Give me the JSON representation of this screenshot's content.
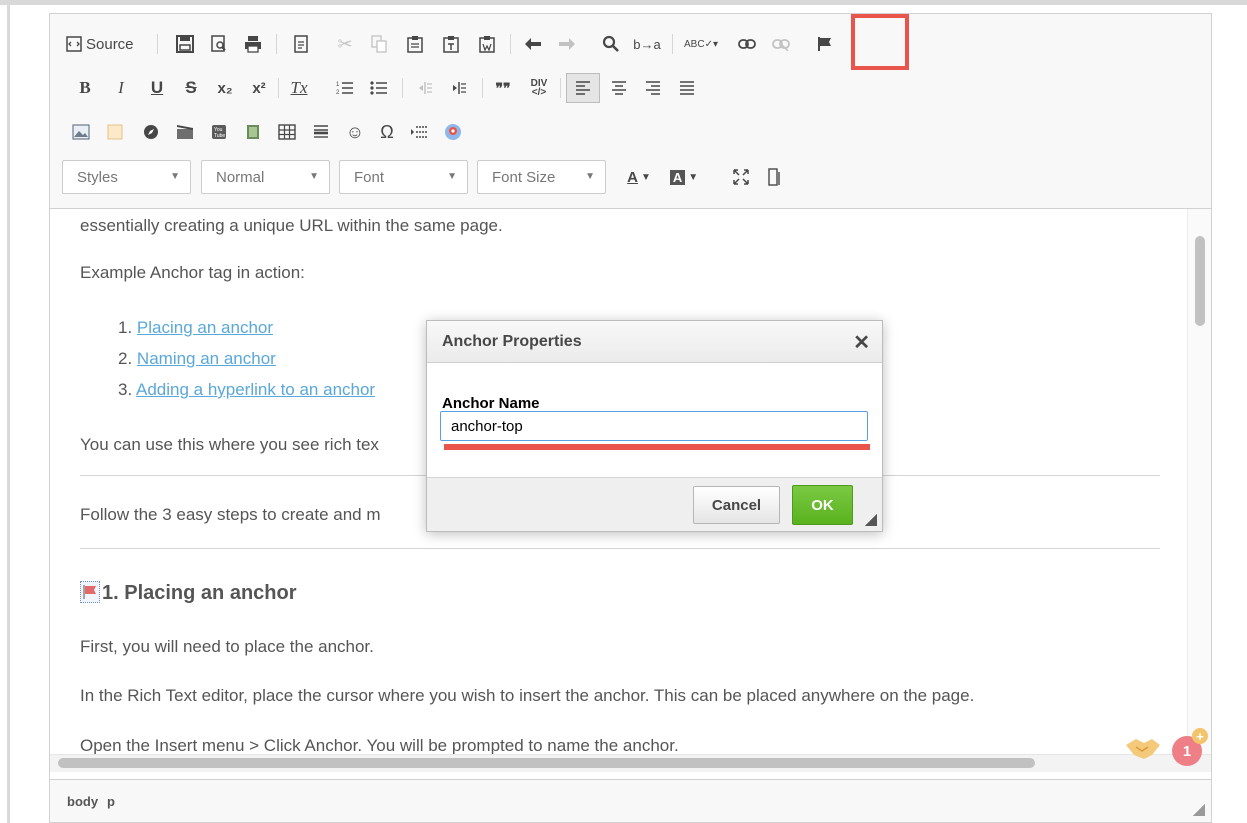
{
  "toolbar": {
    "source_label": "Source",
    "styles_combo": "Styles",
    "format_combo": "Normal",
    "font_combo": "Font",
    "fontsize_combo": "Font Size",
    "bold": "B",
    "italic": "I",
    "underline": "U",
    "strike": "S",
    "subscript": "x₂",
    "superscript": "x²",
    "remove_format": "Tx",
    "blockquote": "❞❞",
    "text_color": "A",
    "bg_color": "A",
    "special_char": "Ω",
    "smiley": "☺"
  },
  "content": {
    "p1": "essentially creating a unique URL within the same page.",
    "p2": "Example Anchor tag in action:",
    "list": [
      {
        "num": "1.",
        "text": "Placing an anchor"
      },
      {
        "num": "2.",
        "text": "Naming an anchor"
      },
      {
        "num": "3.",
        "text": "Adding a hyperlink to an anchor"
      }
    ],
    "p3": "You can use this where you see rich tex",
    "p4": "Follow the 3 easy steps to create and m",
    "heading": "1. Placing an anchor",
    "p5": "First, you will need to place the anchor.",
    "p6": "In the Rich Text editor, place the cursor where you wish to insert the anchor. This can be placed anywhere on the page.",
    "p7": "Open the Insert menu > Click Anchor. You will be prompted to name the anchor."
  },
  "statusbar": {
    "path": [
      "body",
      "p"
    ]
  },
  "dialog": {
    "title": "Anchor Properties",
    "close": "✕",
    "field_label": "Anchor Name",
    "field_value": "anchor-top",
    "cancel": "Cancel",
    "ok": "OK"
  },
  "notification": {
    "count": "1",
    "plus": "+"
  },
  "colors": {
    "highlight": "#e9554a",
    "link": "#5aa7d9",
    "ok_button": "#6cc02e"
  }
}
